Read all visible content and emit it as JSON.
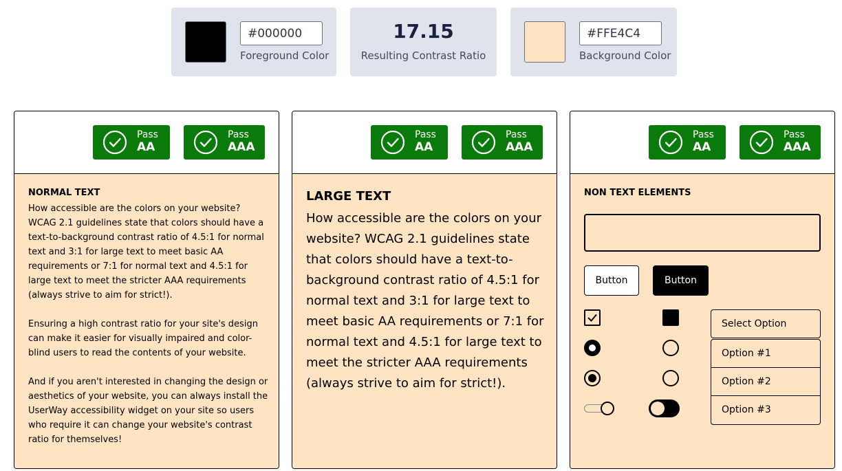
{
  "foreground": {
    "color": "#000000",
    "hex_value": "#000000",
    "label": "Foreground Color"
  },
  "ratio": {
    "value": "17.15",
    "label": "Resulting Contrast Ratio"
  },
  "background": {
    "color": "#FFE4C4",
    "hex_value": "#FFE4C4",
    "label": "Background Color"
  },
  "colors": {
    "pass_green": "#0a7a0a",
    "tile_bg": "#e0e3ec"
  },
  "badges": {
    "pass_label": "Pass",
    "aa_label": "AA",
    "aaa_label": "AAA",
    "icon": "check-circle-icon"
  },
  "normal_panel": {
    "title": "NORMAL TEXT",
    "paragraphs": [
      "How accessible are the colors on your website? WCAG 2.1 guidelines state that colors should have a text-to-background contrast ratio of 4.5:1 for normal text and 3:1 for large text to meet basic AA requirements or 7:1 for normal text and 4.5:1 for large text to meet the stricter AAA requirements (always strive to aim for strict!).",
      "Ensuring a high contrast ratio for your site's design can make it easier for visually impaired and color-blind users to read the contents of your website.",
      "And if you aren't interested in changing the design or aesthetics of your website, you can always install the UserWay accessibility widget on your site so users who require it can change your website's contrast ratio for themselves!"
    ]
  },
  "large_panel": {
    "title": "LARGE TEXT",
    "text": "How accessible are the colors on your website? WCAG 2.1 guidelines state that colors should have a text-to-background contrast ratio of 4.5:1 for normal text and 3:1 for large text to meet basic AA requirements or 7:1 for normal text and 4.5:1 for large text to meet the stricter AAA requirements (always strive to aim for strict!)."
  },
  "nontext_panel": {
    "title": "NON TEXT ELEMENTS",
    "button_outline_label": "Button",
    "button_solid_label": "Button",
    "select_label": "Select Option",
    "options": [
      "Option #1",
      "Option #2",
      "Option #3"
    ]
  }
}
